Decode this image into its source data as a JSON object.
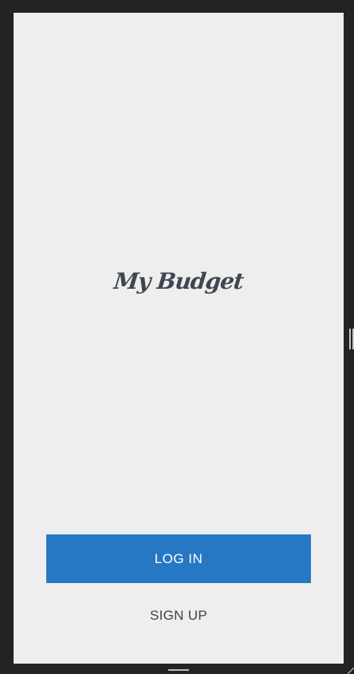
{
  "app": {
    "logo_text": "My Budget"
  },
  "actions": {
    "login_label": "LOG IN",
    "signup_label": "SIGN UP"
  },
  "colors": {
    "background": "#eeeeee",
    "primary": "#2778c4",
    "text_dark": "#3f444a",
    "frame": "#232323"
  },
  "icons": {
    "resize_handle": "vertical-grip-icon",
    "home_indicator": "home-indicator-icon",
    "corner_grip": "resize-corner-icon"
  }
}
